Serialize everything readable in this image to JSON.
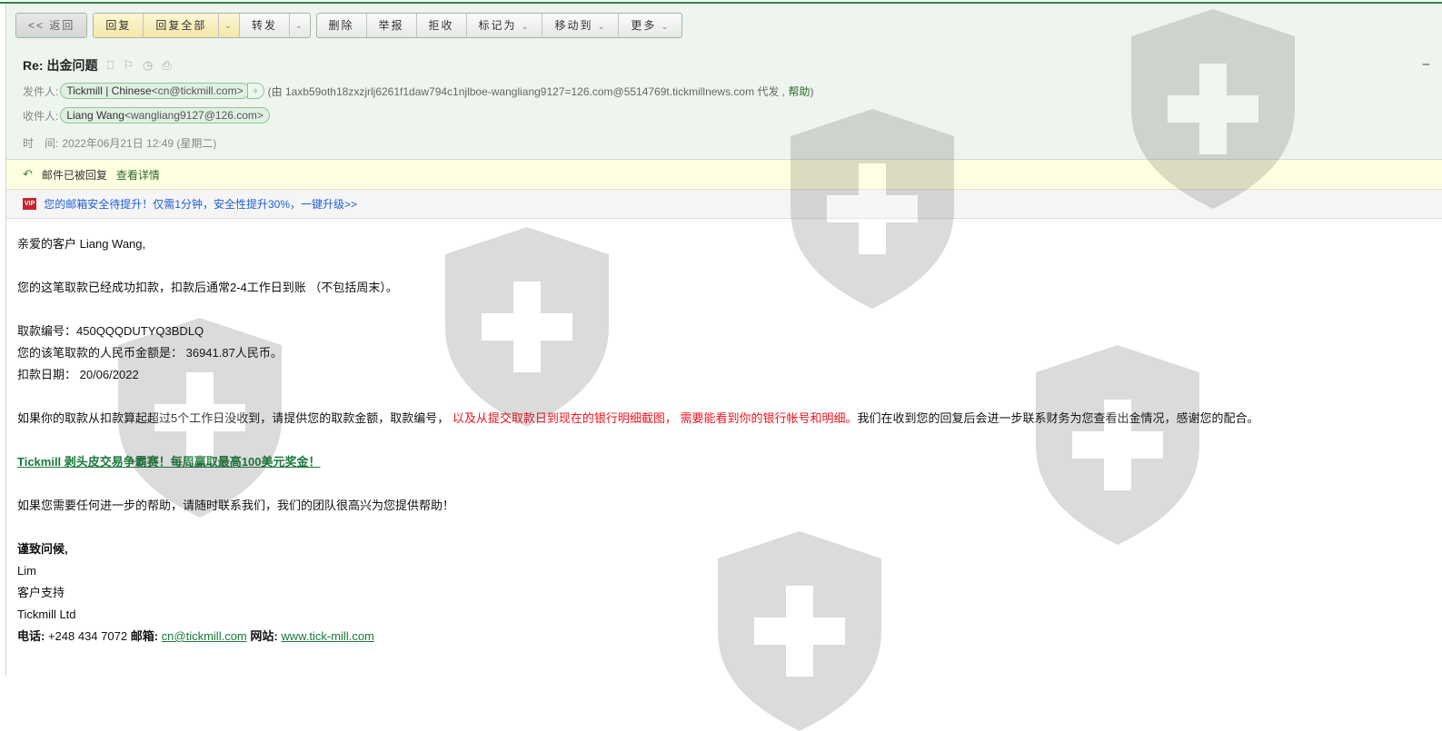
{
  "toolbar": {
    "back": "<< 返回",
    "reply": "回复",
    "reply_all": "回复全部",
    "forward": "转发",
    "delete": "删除",
    "report": "举报",
    "reject": "拒收",
    "mark_as": "标记为",
    "move_to": "移动到",
    "more": "更多"
  },
  "header": {
    "subject": "Re: 出金问题",
    "from_label": "发件人:",
    "from_name": "Tickmill | Chinese",
    "from_email": "<cn@tickmill.com>",
    "via_prefix": "(由 1axb59oth18zxzjrlj6261f1daw794c1njlboe-wangliang9127=126.com@5514769t.tickmillnews.com 代发 ,",
    "via_help": "帮助",
    ")": ")",
    "to_label": "收件人:",
    "to_name": "Liang Wang",
    "to_email": "<wangliang9127@126.com>",
    "time_label": "时　间:",
    "time": "2022年06月21日 12:49 (星期二)"
  },
  "notice": {
    "text": "邮件已被回复",
    "link": "查看详情"
  },
  "vip": {
    "badge": "VIP",
    "text": "您的邮箱安全待提升！仅需1分钟，安全性提升30%，一键升级>>"
  },
  "body": {
    "greeting": "亲爱的客户 Liang Wang,",
    "p1": "您的这笔取款已经成功扣款，扣款后通常2-4工作日到账 （不包括周末）。",
    "id_line": "取款编号：450QQQDUTYQ3BDLQ",
    "amount_line": "您的该笔取款的人民币金额是： 36941.87人民币。",
    "date_line": "扣款日期： 20/06/2022",
    "p2_a": "如果你的取款从扣款算起超过5个工作日没收到，请提供您的取款金额，取款编号， ",
    "p2_red": "以及从提交取款日到现在的银行明细截图， 需要能看到你的银行帐号和明细。",
    "p2_b": "我们在收到您的回复后会进一步联系财务为您查看出金情况，感谢您的配合。",
    "promo": "Tickmill 剥头皮交易争霸赛！每周赢取最高100美元奖金！",
    "p3": "如果您需要任何进一步的帮助，请随时联系我们，我们的团队很高兴为您提供帮助！",
    "regards": "谨致问候,",
    "name": "Lim",
    "role": "客户支持",
    "company": "Tickmill Ltd",
    "phone_label": "电话:",
    "phone": " +248 434 7072 ",
    "email_label": "邮箱:",
    "email": "cn@tickmill.com",
    "site_label": " 网站:",
    "site": "www.tick-mill.com"
  }
}
